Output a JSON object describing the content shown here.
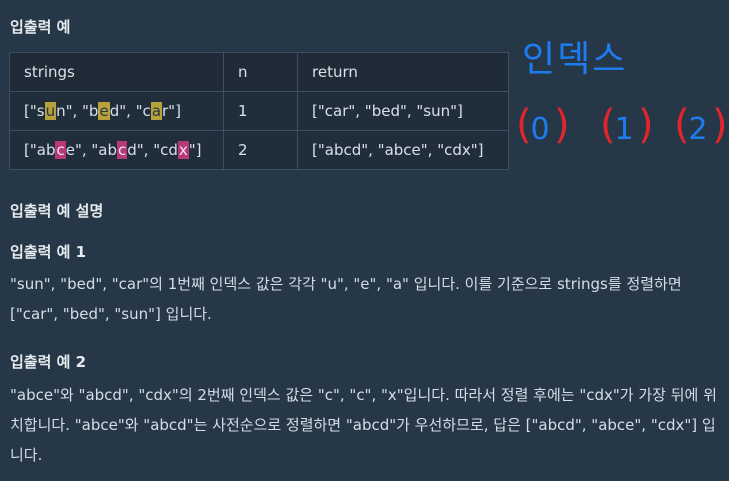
{
  "headings": {
    "io_example": "입출력 예",
    "io_explanation": "입출력 예 설명",
    "example1": "입출력 예 1",
    "example2": "입출력 예 2"
  },
  "table": {
    "headers": [
      "strings",
      "n",
      "return"
    ],
    "rows": [
      {
        "strings_parts": [
          "[\"s",
          "u",
          "n\", \"b",
          "e",
          "d\", \"c",
          "a",
          "r\"]"
        ],
        "n": "1",
        "return": "[\"car\", \"bed\", \"sun\"]"
      },
      {
        "strings_parts": [
          "[\"ab",
          "c",
          "e\", \"ab",
          "c",
          "d\", \"cd",
          "x",
          "\"]"
        ],
        "n": "2",
        "return": "[\"abcd\", \"abce\", \"cdx\"]"
      }
    ]
  },
  "explanations": {
    "example1": "\"sun\", \"bed\", \"car\"의 1번째 인덱스 값은 각각 \"u\", \"e\", \"a\" 입니다. 이를 기준으로 strings를 정렬하면 [\"car\", \"bed\", \"sun\"] 입니다.",
    "example2": "\"abce\"와 \"abcd\", \"cdx\"의 2번째 인덱스 값은 \"c\", \"c\", \"x\"입니다. 따라서 정렬 후에는 \"cdx\"가 가장 뒤에 위치합니다. \"abce\"와 \"abcd\"는 사전순으로 정렬하면 \"abcd\"가 우선하므로, 답은 [\"abcd\", \"abce\", \"cdx\"] 입니다."
  },
  "annotation": {
    "title": "인덱스",
    "indices": [
      "0",
      "1",
      "2"
    ],
    "colors": {
      "text": "#1d7cf2",
      "brackets": "#e0262c"
    }
  },
  "colors": {
    "background": "#263747",
    "highlight_yellow": "#b7a13a",
    "highlight_pink": "#b7397a"
  }
}
